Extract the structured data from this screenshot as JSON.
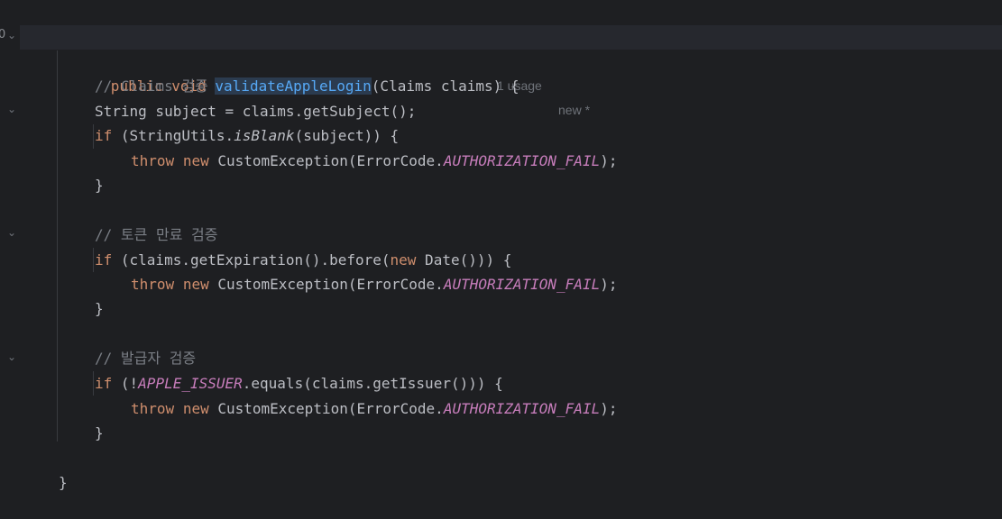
{
  "gutter": {
    "marker": "0"
  },
  "code": {
    "signature": {
      "kw_public": "public",
      "kw_void": "void",
      "method_name": "validateAppleLogin",
      "params": "(Claims claims) {",
      "hint_usages": "1 usage",
      "hint_new": "new *"
    },
    "c1_comment": "// Claims 검증",
    "c1_stmt": "String subject = claims.getSubject();",
    "c1_if_kw": "if",
    "c1_if_open": " (StringUtils.",
    "c1_if_static": "isBlank",
    "c1_if_close": "(subject)) {",
    "c1_throw_kw": "throw",
    "c1_new_kw": "new",
    "c1_exc": " CustomException(ErrorCode.",
    "c1_const": "AUTHORIZATION_FAIL",
    "c1_end": ");",
    "c1_close": "}",
    "c2_comment": "// 토큰 만료 검증",
    "c2_if_kw": "if",
    "c2_if_a": " (claims.getExpiration().before(",
    "c2_new_kw": "new",
    "c2_if_b": " Date())) {",
    "c2_throw_kw": "throw",
    "c2_new2_kw": "new",
    "c2_exc": " CustomException(ErrorCode.",
    "c2_const": "AUTHORIZATION_FAIL",
    "c2_end": ");",
    "c2_close": "}",
    "c3_comment": "// 발급자 검증",
    "c3_if_kw": "if",
    "c3_if_a": " (!",
    "c3_issuer_const": "APPLE_ISSUER",
    "c3_if_b": ".equals(claims.getIssuer())) {",
    "c3_throw_kw": "throw",
    "c3_new_kw": "new",
    "c3_exc": " CustomException(ErrorCode.",
    "c3_const": "AUTHORIZATION_FAIL",
    "c3_end": ");",
    "c3_close": "}",
    "method_close": "}"
  }
}
